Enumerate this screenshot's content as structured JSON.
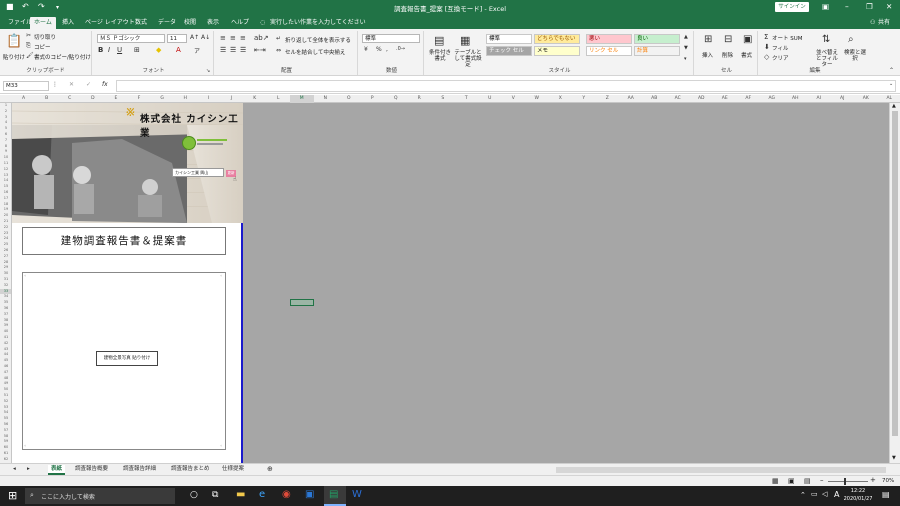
{
  "title_bar": {
    "title": "調査報告書_提案 [互換モード] - Excel",
    "signin": "サインイン"
  },
  "ribbon_tabs": [
    {
      "label": "ファイル"
    },
    {
      "label": "ホーム"
    },
    {
      "label": "挿入"
    },
    {
      "label": "ページ レイアウト"
    },
    {
      "label": "数式"
    },
    {
      "label": "データ"
    },
    {
      "label": "校閲"
    },
    {
      "label": "表示"
    },
    {
      "label": "ヘルプ"
    }
  ],
  "tell_me": "実行したい作業を入力してください",
  "share": "共有",
  "clipboard": {
    "paste": "貼り付け",
    "cut": "切り取り",
    "copy": "コピー",
    "format_painter": "書式のコピー/貼り付け",
    "label": "クリップボード"
  },
  "font": {
    "name": "ＭＳ Ｐゴシック",
    "size": "11",
    "label": "フォント",
    "bold": "B",
    "italic": "I",
    "underline": "U"
  },
  "alignment": {
    "wrap": "折り返して全体を表示する",
    "merge": "セルを結合して中央揃え",
    "label": "配置"
  },
  "number": {
    "format": "標準",
    "percent": "%",
    "comma": ",",
    "label": "数値"
  },
  "styles": {
    "conditional": "条件付き書式",
    "table": "テーブルとして書式設定",
    "cells": [
      {
        "label": "標準",
        "bg": "#ffffff",
        "fg": "#000000"
      },
      {
        "label": "どちらでもない",
        "bg": "#ffeb9c",
        "fg": "#9c5700"
      },
      {
        "label": "悪い",
        "bg": "#ffc7ce",
        "fg": "#9c0006"
      },
      {
        "label": "良い",
        "bg": "#c6efce",
        "fg": "#006100"
      },
      {
        "label": "チェック セル",
        "bg": "#a5a5a5",
        "fg": "#ffffff"
      },
      {
        "label": "メモ",
        "bg": "#ffffcc",
        "fg": "#000000"
      },
      {
        "label": "リンク セル",
        "bg": "#ffffff",
        "fg": "#fa7d00"
      },
      {
        "label": "計算",
        "bg": "#f2f2f2",
        "fg": "#fa7d00"
      }
    ],
    "label": "スタイル"
  },
  "cells_group": {
    "insert": "挿入",
    "delete": "削除",
    "format": "書式",
    "label": "セル"
  },
  "editing": {
    "autosum": "オート SUM",
    "fill": "フィル",
    "clear": "クリア",
    "sort": "並べ替えとフィルター",
    "find": "検索と選択",
    "label": "編集"
  },
  "formula_bar": {
    "name_box": "M33",
    "fx": "fx",
    "cancel": "✕",
    "enter": "✓"
  },
  "columns": [
    "A",
    "B",
    "C",
    "D",
    "E",
    "F",
    "G",
    "H",
    "I",
    "J",
    "K",
    "L",
    "M",
    "N",
    "O",
    "P",
    "Q",
    "R",
    "S",
    "T",
    "U",
    "V",
    "W",
    "X",
    "Y",
    "Z",
    "AA",
    "AB",
    "AC",
    "AD",
    "AE",
    "AF",
    "AG",
    "AH",
    "AI",
    "AJ",
    "AK",
    "AL"
  ],
  "sheet": {
    "company_logo_text": "株式会社 カイシン工業",
    "company_name_small": "カイシン工業 興山",
    "report_title": "建物調査報告書＆提案書",
    "photo_button": "建物全景写真 貼り付け",
    "pink_button": "更新"
  },
  "sheet_tabs": [
    {
      "label": "表紙",
      "active": true
    },
    {
      "label": "調査報告概要",
      "active": false
    },
    {
      "label": "調査報告詳細",
      "active": false
    },
    {
      "label": "調査報告まとめ",
      "active": false
    },
    {
      "label": "仕様提案",
      "active": false
    }
  ],
  "status": {
    "zoom": "70%"
  },
  "taskbar": {
    "search_placeholder": "ここに入力して検索",
    "time": "12:22",
    "date": "2020/01/27",
    "ime": "A"
  }
}
